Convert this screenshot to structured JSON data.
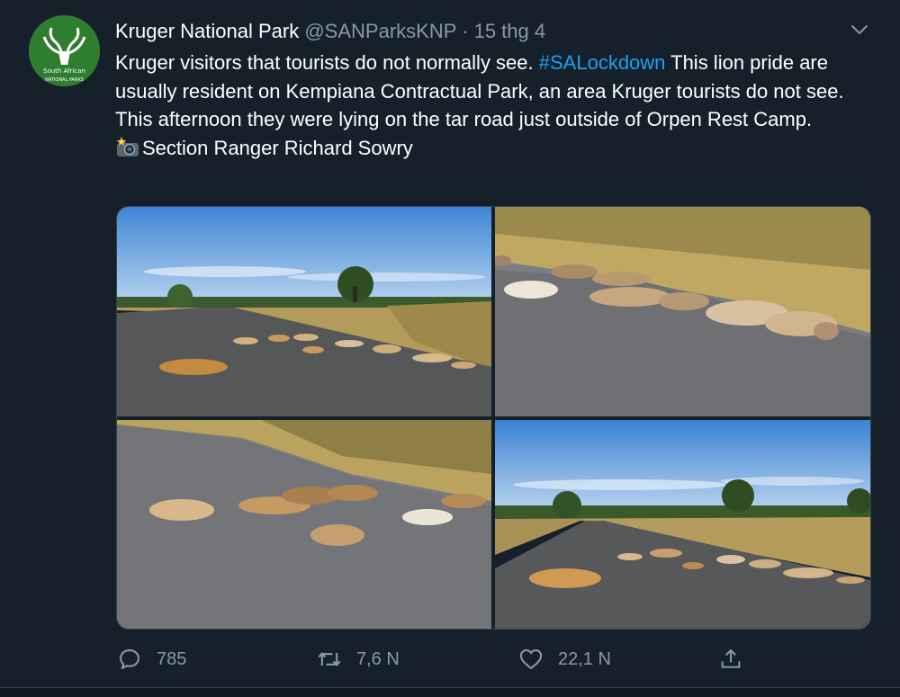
{
  "tweet": {
    "name": "Kruger National Park",
    "handle": "@SANParksKNP",
    "separator": "·",
    "date": "15 thg 4",
    "text_1": "Kruger visitors that tourists do not normally see. ",
    "hashtag": "#SALockdown",
    "text_2": " This lion pride are usually resident on Kempiana Contractual Park, an area Kruger tourists do not see.  This afternoon they were lying on the tar road just outside of Orpen Rest Camp.",
    "credit": "Section Ranger Richard Sowry",
    "avatar_text_1": "South African",
    "avatar_text_2": "NATIONAL PARKS"
  },
  "actions": {
    "replies": "785",
    "retweets": "7,6 N",
    "likes": "22,1 N"
  },
  "colors": {
    "background": "#15202b",
    "secondary_text": "#8899a6",
    "link": "#1da1f2",
    "avatar_bg": "#2f7d2e"
  },
  "icons": [
    "chevron-down-icon",
    "camera-flash-icon",
    "reply-icon",
    "retweet-icon",
    "heart-icon",
    "share-icon"
  ]
}
